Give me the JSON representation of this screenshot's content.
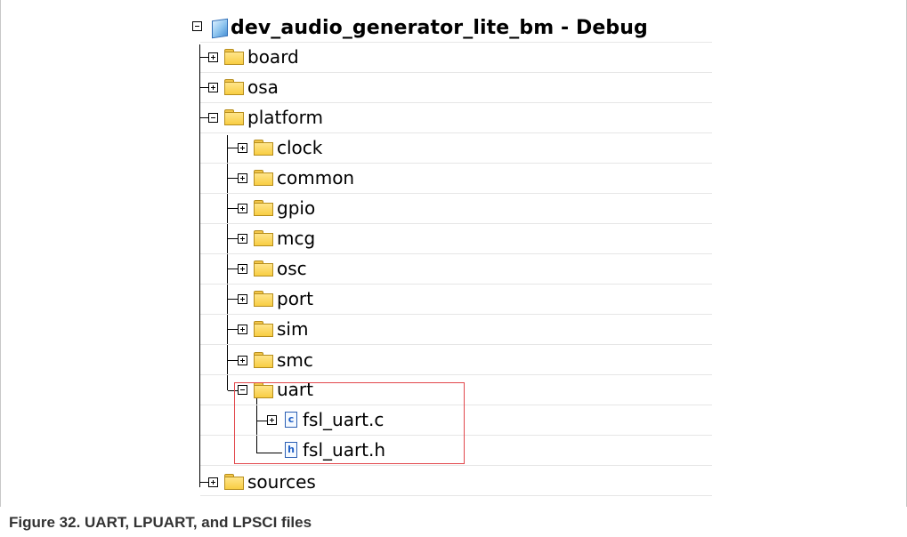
{
  "tree": {
    "project": {
      "name": "dev_audio_generator_lite_bm - Debug",
      "icon": "project-icon",
      "expanded": true
    },
    "board": {
      "name": "board",
      "icon": "folder-icon",
      "expanded": false
    },
    "osa": {
      "name": "osa",
      "icon": "folder-icon",
      "expanded": false
    },
    "platform": {
      "name": "platform",
      "icon": "folder-icon",
      "expanded": true,
      "children": {
        "clock": "clock",
        "common": "common",
        "gpio": "gpio",
        "mcg": "mcg",
        "osc": "osc",
        "port": "port",
        "sim": "sim",
        "smc": "smc",
        "uart": {
          "name": "uart",
          "expanded": true,
          "files": {
            "fsl_uart_c": {
              "name": "fsl_uart.c",
              "icon_letter": "c",
              "expandable": true
            },
            "fsl_uart_h": {
              "name": "fsl_uart.h",
              "icon_letter": "h",
              "expandable": false
            }
          }
        }
      }
    },
    "sources": {
      "name": "sources",
      "icon": "folder-icon",
      "expanded": false
    }
  },
  "highlight_color": "#e2474b",
  "caption": "Figure 32.  UART, LPUART, and LPSCI files"
}
